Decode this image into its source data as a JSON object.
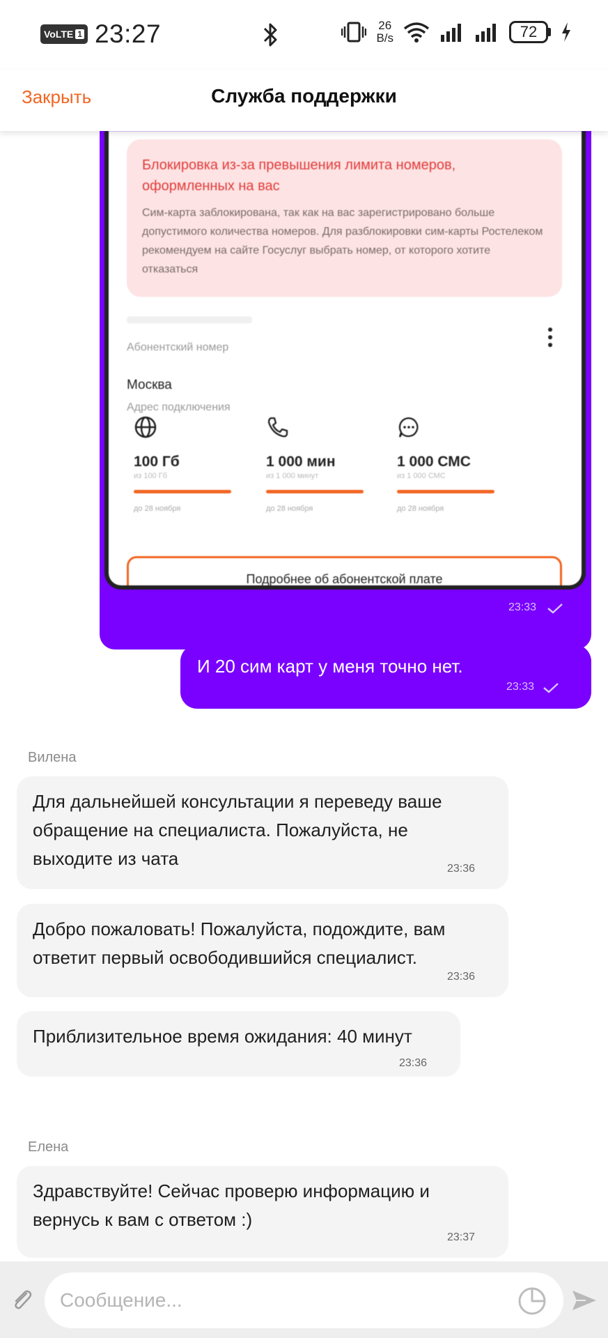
{
  "status_bar": {
    "volte": "VoLTE",
    "sim": "1",
    "time": "23:27",
    "speed_value": "26",
    "speed_unit": "B/s",
    "battery": "72",
    "icons": [
      "bluetooth-icon",
      "vibrate-icon",
      "wifi-icon",
      "signal-icon",
      "signal-icon",
      "battery-icon",
      "charging-icon"
    ]
  },
  "header": {
    "close_label": "Закрыть",
    "title": "Служба поддержки",
    "accent_color": "#f26522"
  },
  "attachment": {
    "alert_title": "Блокировка из-за превышения лимита номеров, оформленных на вас",
    "alert_text": "Сим-карта заблокирована, так как на вас зарегистрировано больше допустимого количества номеров. Для разблокировки сим-карты Ростелеком рекомендуем на сайте Госуслуг выбрать номер, от которого хотите отказаться",
    "number_label": "Абонентский номер",
    "city": "Москва",
    "address_label": "Адрес подключения",
    "stats": [
      {
        "icon": "globe-icon",
        "value": "100 Гб",
        "sub": "из 100 Гб",
        "until": "до 28 ноября"
      },
      {
        "icon": "phone-icon",
        "value": "1 000 мин",
        "sub": "из 1 000 минут",
        "until": "до 28 ноября"
      },
      {
        "icon": "chat-icon",
        "value": "1 000 СМС",
        "sub": "из 1 000 СМС",
        "until": "до 28 ноября"
      }
    ],
    "more_button": "Подробнее об абонентской плате",
    "time": "23:33"
  },
  "messages": [
    {
      "direction": "out",
      "text": "И 20 сим карт у меня точно нет.",
      "time": "23:33"
    },
    {
      "direction": "in",
      "sender": "Вилена",
      "text": "Для дальнейшей консультации я переведу ваше обращение на специалиста. Пожалуйста, не выходите из чата",
      "time": "23:36"
    },
    {
      "direction": "in",
      "text": "Добро пожаловать! Пожалуйста, подождите, вам ответит первый освободившийся специалист.",
      "time": "23:36"
    },
    {
      "direction": "in",
      "text": "Приблизительное время ожидания: 40 минут",
      "time": "23:36"
    },
    {
      "direction": "in",
      "sender": "Елена",
      "text": "Здравствуйте! Сейчас проверю информацию и вернусь к вам с ответом :)",
      "time": "23:37"
    }
  ],
  "input": {
    "placeholder": "Сообщение..."
  },
  "colors": {
    "outgoing_bubble": "#7a00ff",
    "incoming_bubble": "#f4f4f4"
  }
}
